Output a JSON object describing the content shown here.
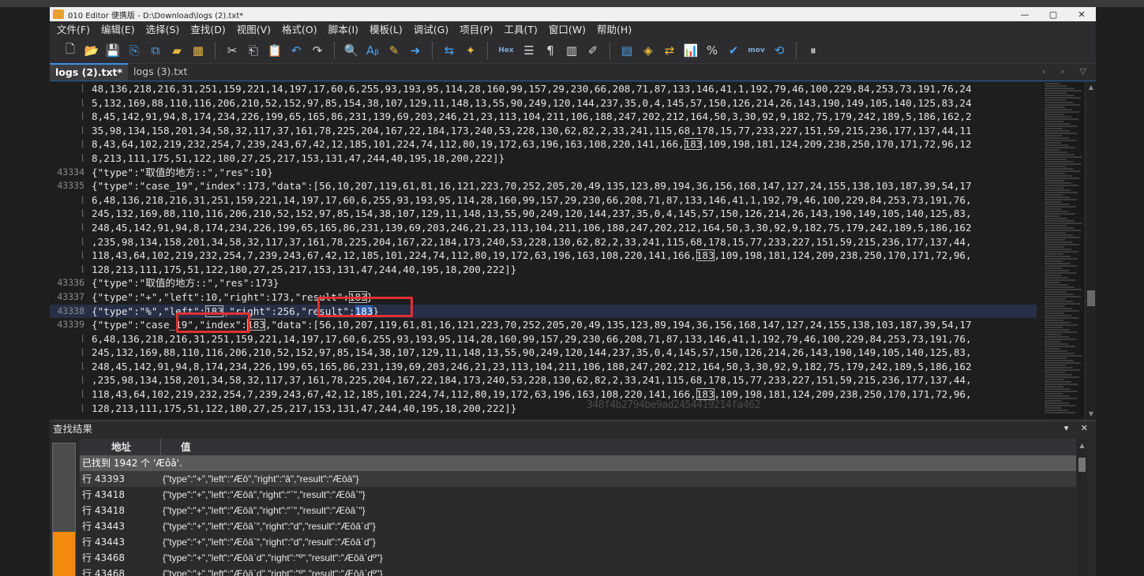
{
  "window": {
    "title": "010 Editor 便携版 - D:\\Download\\logs (2).txt*",
    "controls": [
      "—",
      "▢",
      "✕"
    ]
  },
  "menu": [
    "文件(F)",
    "编辑(E)",
    "选择(S)",
    "查找(D)",
    "视图(V)",
    "格式(O)",
    "脚本(I)",
    "模板(L)",
    "调试(G)",
    "项目(P)",
    "工具(T)",
    "窗口(W)",
    "帮助(H)"
  ],
  "toolbar": {
    "hex_label": "Hex",
    "mov_label": "mov"
  },
  "tabs": [
    {
      "label": "logs (2).txt*",
      "active": true
    },
    {
      "label": "logs (3).txt",
      "active": false
    }
  ],
  "tab_nav": "‹ › ▽",
  "editor": {
    "lines": [
      {
        "num": "",
        "text": "48,136,218,216,31,251,159,221,14,197,17,60,6,255,93,193,95,114,28,160,99,157,29,230,66,208,71,87,133,146,41,1,192,79,46,100,229,84,253,73,191,76,24"
      },
      {
        "num": "",
        "text": "5,132,169,88,110,116,206,210,52,152,97,85,154,38,107,129,11,148,13,55,90,249,120,144,237,35,0,4,145,57,150,126,214,26,143,190,149,105,140,125,83,24"
      },
      {
        "num": "",
        "text": "8,45,142,91,94,8,174,234,226,199,65,165,86,231,139,69,203,246,21,23,113,104,211,106,188,247,202,212,164,50,3,30,92,9,182,75,179,242,189,5,186,162,2"
      },
      {
        "num": "",
        "text": "35,98,134,158,201,34,58,32,117,37,161,78,225,204,167,22,184,173,240,53,228,130,62,82,2,33,241,115,68,178,15,77,233,227,151,59,215,236,177,137,44,11"
      },
      {
        "num": "",
        "pre": "8,43,64,102,219,232,254,7,239,243,67,42,12,185,101,224,74,112,80,19,172,63,196,163,108,220,141,166,",
        "boxed": "183",
        "post": ",109,198,181,124,209,238,250,170,171,72,96,12"
      },
      {
        "num": "",
        "text": "8,213,111,175,51,122,180,27,25,217,153,131,47,244,40,195,18,200,222]}"
      },
      {
        "num": "43334",
        "text": "{\"type\":\"取值的地方::\",\"res\":10}"
      },
      {
        "num": "43335",
        "text": "{\"type\":\"case_19\",\"index\":173,\"data\":[56,10,207,119,61,81,16,121,223,70,252,205,20,49,135,123,89,194,36,156,168,147,127,24,155,138,103,187,39,54,17"
      },
      {
        "num": "",
        "text": "6,48,136,218,216,31,251,159,221,14,197,17,60,6,255,93,193,95,114,28,160,99,157,29,230,66,208,71,87,133,146,41,1,192,79,46,100,229,84,253,73,191,76,"
      },
      {
        "num": "",
        "text": "245,132,169,88,110,116,206,210,52,152,97,85,154,38,107,129,11,148,13,55,90,249,120,144,237,35,0,4,145,57,150,126,214,26,143,190,149,105,140,125,83,"
      },
      {
        "num": "",
        "text": "248,45,142,91,94,8,174,234,226,199,65,165,86,231,139,69,203,246,21,23,113,104,211,106,188,247,202,212,164,50,3,30,92,9,182,75,179,242,189,5,186,162"
      },
      {
        "num": "",
        "text": ",235,98,134,158,201,34,58,32,117,37,161,78,225,204,167,22,184,173,240,53,228,130,62,82,2,33,241,115,68,178,15,77,233,227,151,59,215,236,177,137,44,"
      },
      {
        "num": "",
        "pre": "118,43,64,102,219,232,254,7,239,243,67,42,12,185,101,224,74,112,80,19,172,63,196,163,108,220,141,166,",
        "boxed": "183",
        "post": ",109,198,181,124,209,238,250,170,171,72,96,"
      },
      {
        "num": "",
        "text": "128,213,111,175,51,122,180,27,25,217,153,131,47,244,40,195,18,200,222]}"
      },
      {
        "num": "43336",
        "text": "{\"type\":\"取值的地方::\",\"res\":173}"
      },
      {
        "num": "43337",
        "pre": "{\"type\":\"+\",\"left\":10,\"right\":173,\"result\":",
        "boxed": "183",
        "post": "}"
      },
      {
        "num": "43338",
        "hl": true,
        "pre": "{\"type\":\"%\",\"left\":",
        "boxed": "183",
        "post": ",\"right\":256,\"result\":",
        "sel": "183",
        "tail": "}"
      },
      {
        "num": "43339",
        "pre": "{\"type\":\"case_19\",\"index\":",
        "boxed": "183",
        "post": ",\"data\":[56,10,207,119,61,81,16,121,223,70,252,205,20,49,135,123,89,194,36,156,168,147,127,24,155,138,103,187,39,54,17"
      },
      {
        "num": "",
        "text": "6,48,136,218,216,31,251,159,221,14,197,17,60,6,255,93,193,95,114,28,160,99,157,29,230,66,208,71,87,133,146,41,1,192,79,46,100,229,84,253,73,191,76,"
      },
      {
        "num": "",
        "text": "245,132,169,88,110,116,206,210,52,152,97,85,154,38,107,129,11,148,13,55,90,249,120,144,237,35,0,4,145,57,150,126,214,26,143,190,149,105,140,125,83,"
      },
      {
        "num": "",
        "text": "248,45,142,91,94,8,174,234,226,199,65,165,86,231,139,69,203,246,21,23,113,104,211,106,188,247,202,212,164,50,3,30,92,9,182,75,179,242,189,5,186,162"
      },
      {
        "num": "",
        "text": ",235,98,134,158,201,34,58,32,117,37,161,78,225,204,167,22,184,173,240,53,228,130,62,82,2,33,241,115,68,178,15,77,233,227,151,59,215,236,177,137,44,"
      },
      {
        "num": "",
        "pre": "118,43,64,102,219,232,254,7,239,243,67,42,12,185,101,224,74,112,80,19,172,63,196,163,108,220,141,166,",
        "boxed": "183",
        "post": ",109,198,181,124,209,238,250,170,171,72,96,"
      },
      {
        "num": "",
        "text": "128,213,111,175,51,122,180,27,25,217,153,131,47,244,40,195,18,200,222]}"
      }
    ],
    "watermark": "348f4b2794be9ad2454419214fa462"
  },
  "find_results": {
    "title": "查找结果",
    "controls": "▾ ✕",
    "col_address": "地址",
    "col_value": "值",
    "summary": "已找到 1942 个 'Æôâ'.",
    "rows": [
      {
        "line": "行 43393",
        "value": "{\"type\":\"+\",\"left\":\"Æô\",\"right\":\"â\",\"result\":\"Æôâ\"}",
        "sel": true
      },
      {
        "line": "行 43418",
        "value": "{\"type\":\"+\",\"left\":\"Æôâ\",\"right\":\"`\",\"result\":\"Æôâ`\"}",
        "sel": false
      },
      {
        "line": "行 43418",
        "value": "{\"type\":\"+\",\"left\":\"Æôâ\",\"right\":\"`\",\"result\":\"Æôâ`\"}",
        "sel": false
      },
      {
        "line": "行 43443",
        "value": "{\"type\":\"+\",\"left\":\"Æôâ`\",\"right\":\"d\",\"result\":\"Æôâ`d\"}",
        "sel": false
      },
      {
        "line": "行 43443",
        "value": "{\"type\":\"+\",\"left\":\"Æôâ`\",\"right\":\"d\",\"result\":\"Æôâ`d\"}",
        "sel": false
      },
      {
        "line": "行 43468",
        "value": "{\"type\":\"+\",\"left\":\"Æôâ`d\",\"right\":\"º\",\"result\":\"Æôâ`dº\"}",
        "sel": false
      },
      {
        "line": "行 43468",
        "value": "{\"type\":\"+\",\"left\":\"Æôâ`d\",\"right\":\"º\",\"result\":\"Æôâ`dº\"}",
        "sel": false
      }
    ]
  }
}
